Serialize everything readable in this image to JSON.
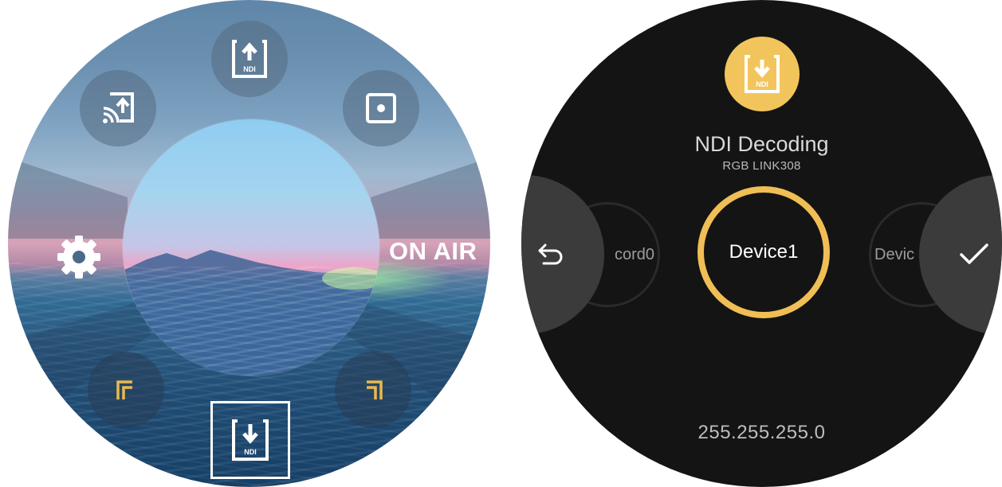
{
  "left_screen": {
    "on_air_label": "ON AIR",
    "bottom_item_badge": "NDI",
    "top_item_badge": "NDI",
    "icons": {
      "top": "ndi-upload-icon",
      "top_left": "cast-icon",
      "top_right": "record-icon",
      "left": "gear-icon",
      "bottom_left": "corner-bracket-icon",
      "bottom_right": "corner-bracket-icon",
      "bottom": "ndi-download-icon"
    },
    "colors": {
      "accent": "#f0be55",
      "bubble": "#556c82"
    }
  },
  "right_screen": {
    "badge_text": "NDI",
    "title": "NDI Decoding",
    "subtitle": "RGB LINK308",
    "selected_device": "Device1",
    "prev_item": "cord0",
    "next_item": "Devic",
    "ip_address": "255.255.255.0",
    "icons": {
      "badge": "ndi-download-icon",
      "back": "back-arrow-icon",
      "confirm": "checkmark-icon"
    },
    "colors": {
      "accent": "#f0be55",
      "background": "#141414",
      "side_panel": "#3b3b3b"
    }
  }
}
